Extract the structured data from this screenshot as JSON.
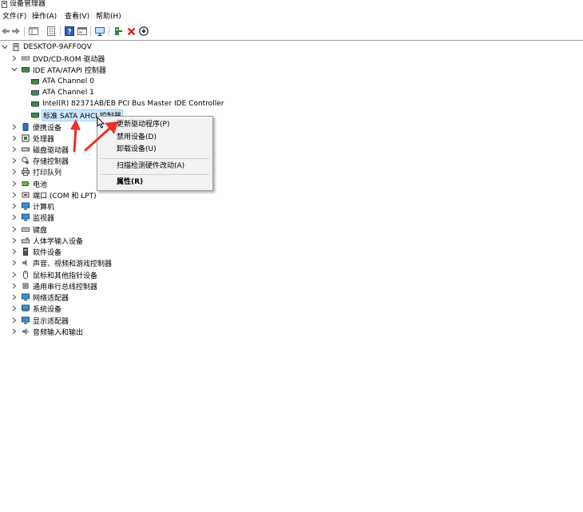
{
  "window": {
    "title": "设备管理器"
  },
  "menu": [
    "文件(F)",
    "操作(A)",
    "查看(V)",
    "帮助(H)"
  ],
  "tree": {
    "root": "DESKTOP-9AFF0QV",
    "categories": [
      {
        "label": "DVD/CD-ROM 驱动器",
        "icon": "dvd-drive-icon",
        "expanded": false
      },
      {
        "label": "IDE ATA/ATAPI 控制器",
        "icon": "ide-controller-icon",
        "expanded": true,
        "children": [
          "ATA Channel 0",
          "ATA Channel 1",
          "Intel(R) 82371AB/EB PCI Bus Master IDE Controller",
          "标准 SATA AHCI 控制器"
        ]
      },
      {
        "label": "便携设备",
        "icon": "portable-device-icon",
        "expanded": false
      },
      {
        "label": "处理器",
        "icon": "processor-icon",
        "expanded": false
      },
      {
        "label": "磁盘驱动器",
        "icon": "disk-drive-icon",
        "expanded": false
      },
      {
        "label": "存储控制器",
        "icon": "storage-controller-icon",
        "expanded": false
      },
      {
        "label": "打印队列",
        "icon": "print-queue-icon",
        "expanded": false
      },
      {
        "label": "电池",
        "icon": "battery-icon",
        "expanded": false
      },
      {
        "label": "端口 (COM 和 LPT)",
        "icon": "port-icon",
        "expanded": false
      },
      {
        "label": "计算机",
        "icon": "computer-icon",
        "expanded": false
      },
      {
        "label": "监视器",
        "icon": "monitor-icon",
        "expanded": false
      },
      {
        "label": "键盘",
        "icon": "keyboard-icon",
        "expanded": false
      },
      {
        "label": "人体学输入设备",
        "icon": "hid-icon",
        "expanded": false
      },
      {
        "label": "软件设备",
        "icon": "software-device-icon",
        "expanded": false
      },
      {
        "label": "声音、视频和游戏控制器",
        "icon": "sound-icon",
        "expanded": false
      },
      {
        "label": "鼠标和其他指针设备",
        "icon": "mouse-icon",
        "expanded": false
      },
      {
        "label": "通用串行总线控制器",
        "icon": "usb-icon",
        "expanded": false
      },
      {
        "label": "网络适配器",
        "icon": "network-adapter-icon",
        "expanded": false
      },
      {
        "label": "系统设备",
        "icon": "system-device-icon",
        "expanded": false
      },
      {
        "label": "显示适配器",
        "icon": "display-adapter-icon",
        "expanded": false
      },
      {
        "label": "音频输入和输出",
        "icon": "audio-io-icon",
        "expanded": false
      }
    ]
  },
  "context_menu": {
    "items": [
      "更新驱动程序(P)",
      "禁用设备(D)",
      "卸载设备(U)",
      "扫描检测硬件改动(A)",
      "属性(R)"
    ]
  },
  "colors": {
    "selection": "#cce8ff",
    "annotation_arrow": "#e8322a"
  }
}
